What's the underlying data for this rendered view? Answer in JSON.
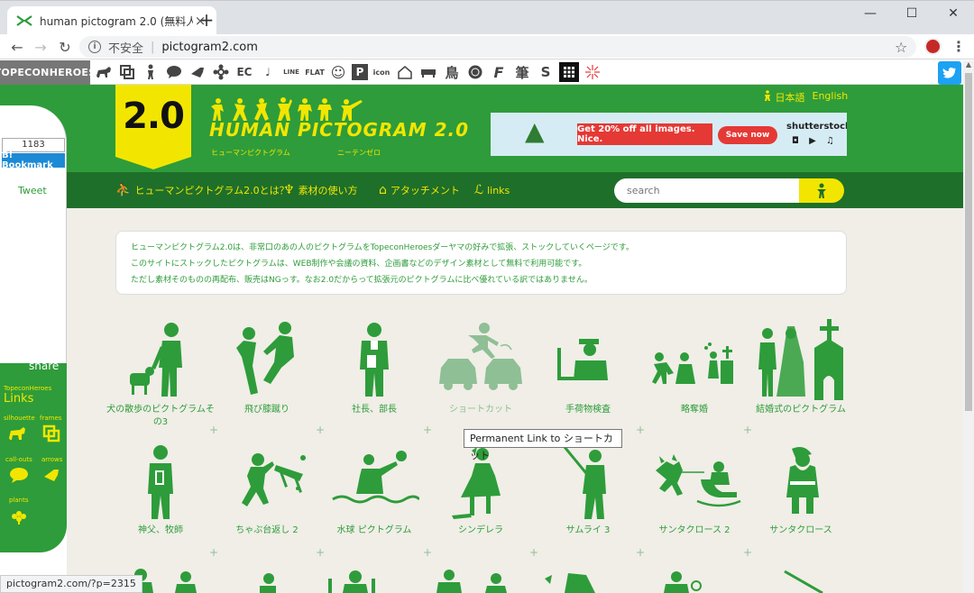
{
  "browser": {
    "tab_title": "human pictogram 2.0 (無料人物",
    "close_tab": "×",
    "new_tab": "+",
    "insecure_label": "不安全",
    "url": "pictogram2.com",
    "status_url": "pictogram2.com/?p=2315"
  },
  "sitebar": {
    "brand": "TOPECONHEROES",
    "icons": [
      "",
      "",
      "",
      "",
      "",
      "",
      "EC",
      "♩",
      "LINE",
      "FLAT",
      "☺",
      "P",
      "icon",
      "",
      "",
      "鳥",
      "",
      "F",
      "筆",
      "S",
      "",
      ""
    ]
  },
  "header": {
    "badge": "2.0",
    "title": "HUMAN PICTOGRAM 2.0",
    "sub_left": "ヒューマンピクトグラム",
    "sub_right": "ニーテンゼロ",
    "lang_ja": "日本語",
    "lang_en": "English"
  },
  "ad": {
    "offer": "Get 20% off all images. Nice.",
    "cta": "Save now",
    "brand": "shutterstock"
  },
  "nav": {
    "items": [
      {
        "label": "ヒューマンピクトグラム2.0とは？"
      },
      {
        "label": "素材の使い方"
      },
      {
        "label": "アタッチメント"
      },
      {
        "label": "links"
      }
    ],
    "search_placeholder": "search"
  },
  "sidebar": {
    "bookmark_count": "1183",
    "bookmark_label": "B! Bookmark",
    "tweet_label": "Tweet",
    "share_label": "share",
    "links_sub": "TopeconHeroes",
    "links_label": "Links",
    "items": [
      "silhouette",
      "frames",
      "call-outs",
      "arrows",
      "plants"
    ]
  },
  "intro": {
    "line1": "ヒューマンピクトグラム2.0は、非常口のあの人のピクトグラムをTopeconHeroesダーヤマの好みで拡張、ストックしていくページです。",
    "line2": "このサイトにストックしたピクトグラムは、WEB制作や会議の資料、企画書などのデザイン素材として無料で利用可能です。",
    "line3": "ただし素材そのものの再配布、販売はNGっす。なお2.0だからって拡張元のピクトグラムに比べ優れている訳ではありません。"
  },
  "pictograms": {
    "row1": [
      "犬の散歩のピクトグラムその3",
      "飛び膝蹴り",
      "社長、部長",
      "ショートカット",
      "手荷物検査",
      "略奪婚",
      "結婚式のピクトグラム"
    ],
    "row2": [
      "神父、牧師",
      "ちゃぶ台返し 2",
      "水球 ピクトグラム",
      "シンデレラ",
      "サムライ 3",
      "サンタクロース 2",
      "サンタクロース"
    ]
  },
  "tooltip": "Permanent Link to ショートカット",
  "colors": {
    "green": "#2e9c3a",
    "dark_green": "#1e6f2a",
    "yellow": "#f2e600",
    "background": "#f0eee7"
  }
}
